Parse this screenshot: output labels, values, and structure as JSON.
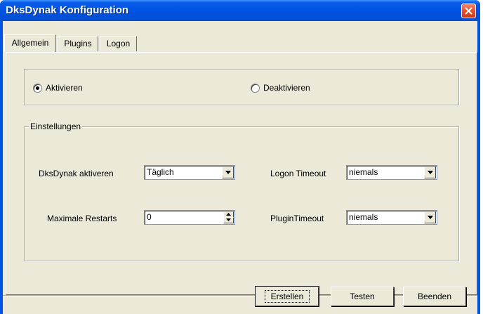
{
  "window": {
    "title": "DksDynak Konfiguration"
  },
  "tabs": [
    {
      "label": "Allgemein",
      "active": true
    },
    {
      "label": "Plugins",
      "active": false
    },
    {
      "label": "Logon",
      "active": false
    }
  ],
  "activation": {
    "options": [
      {
        "label": "Aktivieren",
        "selected": true
      },
      {
        "label": "Deaktivieren",
        "selected": false
      }
    ]
  },
  "settings": {
    "legend": "Einstellungen",
    "dksdynak_label": "DksDynak aktiveren",
    "dksdynak_value": "Täglich",
    "max_restarts_label": "Maximale Restarts",
    "max_restarts_value": "0",
    "logon_timeout_label": "Logon Timeout",
    "logon_timeout_value": "niemals",
    "plugin_timeout_label": "PluginTimeout",
    "plugin_timeout_value": "niemals"
  },
  "buttons": {
    "create": "Erstellen",
    "test": "Testen",
    "quit": "Beenden"
  },
  "colors": {
    "titlebar": "#0054e3",
    "client": "#ece9d8",
    "close": "#e2532c"
  }
}
